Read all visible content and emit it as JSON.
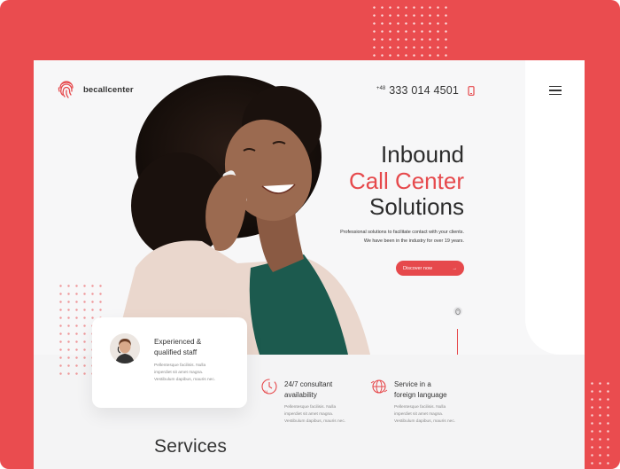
{
  "brand": {
    "name": "becallcenter"
  },
  "header": {
    "phone_prefix": "+48",
    "phone_number": "333 014 4501"
  },
  "hero": {
    "title_line1": "Inbound",
    "title_line2": "Call Center",
    "title_line3": "Solutions",
    "subtitle_line1": "Professional solutions to facilitate contact with your clients.",
    "subtitle_line2": "We have been in the industry for over 19 years.",
    "cta_label": "Discover now",
    "cta_arrow": "→"
  },
  "staff_card": {
    "title_line1": "Experienced &",
    "title_line2": "qualified staff",
    "text_line1": "Pellentesque facilisis. Nulla",
    "text_line2": "imperdiet sit amet magna.",
    "text_line3": "Vestibulum dapibus, mauris nec."
  },
  "features": [
    {
      "title_line1": "24/7 consultant",
      "title_line2": "availability",
      "text_line1": "Pellentesque facilisis. Nulla",
      "text_line2": "imperdiet sit amet magna.",
      "text_line3": "Vestibulum dapibus, mauris nec.",
      "icon": "clock-icon"
    },
    {
      "title_line1": "Service in a",
      "title_line2": "foreign language",
      "text_line1": "Pellentesque facilisis. Nulla",
      "text_line2": "imperdiet sit amet magna.",
      "text_line3": "Vestibulum dapibus, mauris nec.",
      "icon": "globe-icon"
    }
  ],
  "sections": {
    "services_heading": "Services"
  },
  "colors": {
    "accent": "#e6494c",
    "frame": "#ea4c4f",
    "text": "#2c2c2c"
  }
}
